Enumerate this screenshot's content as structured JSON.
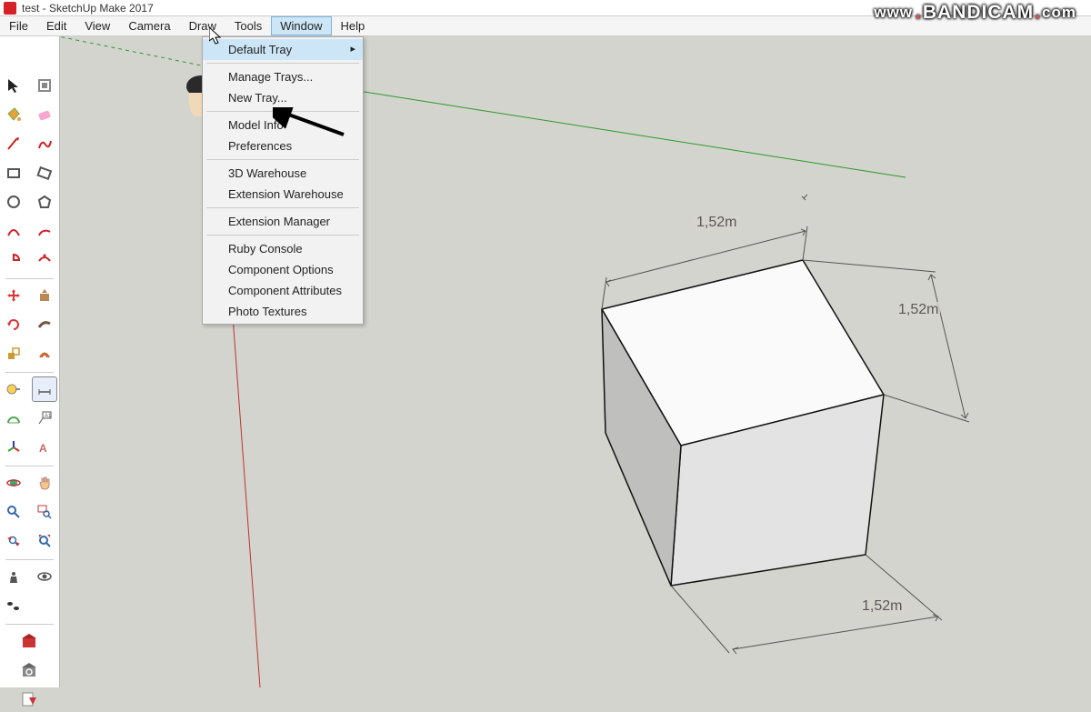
{
  "title": "test - SketchUp Make 2017",
  "watermark": {
    "prefix": "www",
    "name": "BANDICAM",
    "suffix": "com"
  },
  "menu": {
    "items": [
      "File",
      "Edit",
      "View",
      "Camera",
      "Draw",
      "Tools",
      "Window",
      "Help"
    ],
    "open_index": 6
  },
  "window_dropdown": {
    "items": [
      {
        "label": "Default Tray",
        "arrow": true,
        "hover": true
      },
      {
        "sep": true
      },
      {
        "label": "Manage Trays..."
      },
      {
        "label": "New Tray..."
      },
      {
        "sep": true
      },
      {
        "label": "Model Info"
      },
      {
        "label": "Preferences"
      },
      {
        "sep": true
      },
      {
        "label": "3D Warehouse"
      },
      {
        "label": "Extension Warehouse"
      },
      {
        "sep": true
      },
      {
        "label": "Extension Manager"
      },
      {
        "sep": true
      },
      {
        "label": "Ruby Console"
      },
      {
        "label": "Component Options"
      },
      {
        "label": "Component Attributes"
      },
      {
        "label": "Photo Textures"
      }
    ]
  },
  "tools": {
    "groups": [
      [
        "select-icon",
        "component-icon"
      ],
      [
        "paint-bucket-icon",
        "eraser-icon"
      ],
      [
        "pencil-icon",
        "freehand-icon"
      ],
      [
        "rectangle-icon",
        "rotated-rect-icon"
      ],
      [
        "circle-icon",
        "polygon-icon"
      ],
      [
        "arc-icon",
        "arc2-icon"
      ],
      [
        "pie-icon",
        "arc3-icon"
      ],
      [
        "",
        ""
      ],
      [
        "move-icon",
        "pushpull-icon"
      ],
      [
        "rotate-icon",
        "followme-icon"
      ],
      [
        "scale-icon",
        "offset-icon"
      ],
      [
        "tape-icon",
        "dimension-icon"
      ],
      [
        "protractor-icon",
        "text-icon"
      ],
      [
        "axes-icon",
        "3dtext-icon"
      ],
      [
        "",
        ""
      ],
      [
        "orbit-icon",
        "pan-icon"
      ],
      [
        "zoom-icon",
        "zoom-window-icon"
      ],
      [
        "previous-icon",
        "zoom-extents-icon"
      ],
      [
        "",
        ""
      ],
      [
        "section-icon",
        "walk-icon"
      ],
      [
        "lookaround-icon",
        ""
      ],
      [
        "",
        ""
      ]
    ],
    "bottom": [
      "warehouse-icon",
      "extension-icon",
      "send-icon"
    ]
  },
  "dimensions": {
    "top": "1,52m",
    "right": "1,52m",
    "bottom": "1,52m"
  }
}
